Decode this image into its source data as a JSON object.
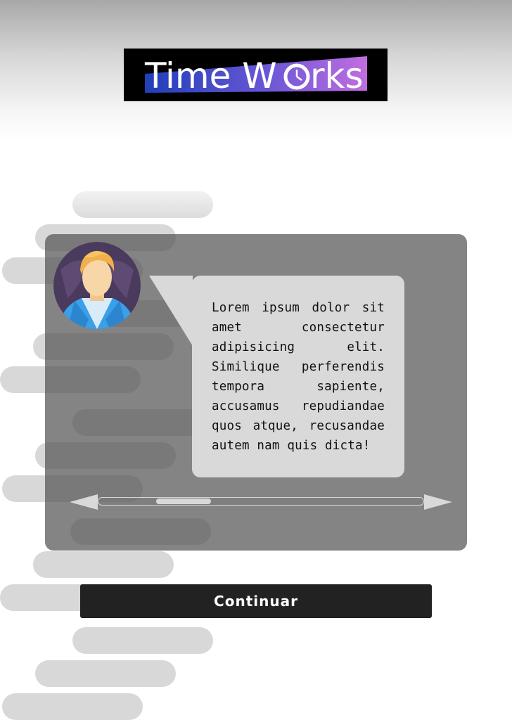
{
  "header": {
    "logo": {
      "text_main": "Time W",
      "text_end": "rks",
      "icon": "clock-icon",
      "colors": {
        "background": "#000000",
        "band_left": "#1f3fb8",
        "band_right": "#c26de0",
        "text": "#ffffff"
      }
    }
  },
  "dialog": {
    "avatar": "male-avatar-icon",
    "message": "Lorem ipsum dolor sit amet consectetur adipisicing elit. Similique perferendis tempora sapiente, accusamus repudiandae quos atque, recusandae autem nam quis dicta!",
    "scrollbar": {
      "left_icon": "arrow-left-icon",
      "right_icon": "arrow-right-icon",
      "position": 0.18
    }
  },
  "actions": {
    "continue_label": "Continuar"
  },
  "colors": {
    "overlay": "#555555",
    "bubble": "#d9d9d9",
    "button": "#222222",
    "placeholder_pill": "#d8d8d8"
  }
}
